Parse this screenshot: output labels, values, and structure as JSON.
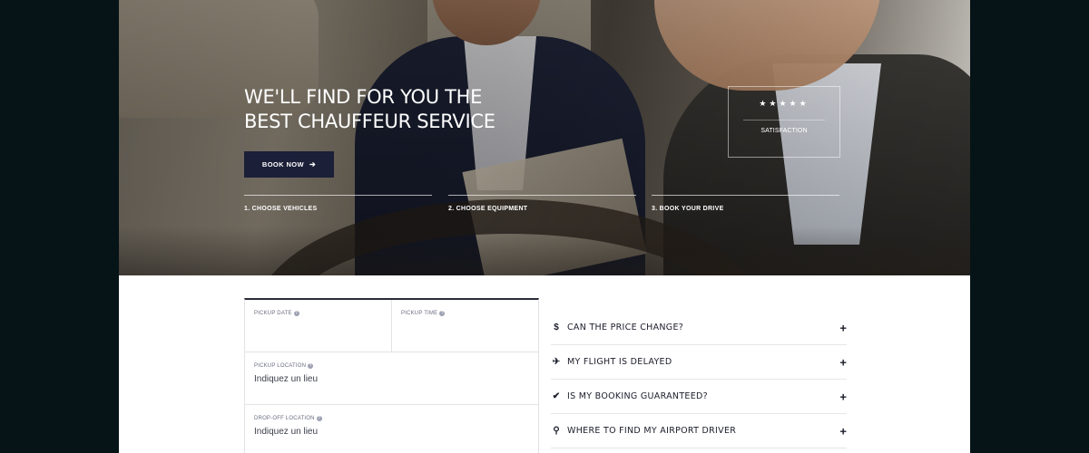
{
  "hero": {
    "title_line1": "WE'LL FIND FOR YOU THE",
    "title_line2": "BEST CHAUFFEUR SERVICE",
    "book_button": "BOOK NOW",
    "book_arrow": "➔",
    "steps": [
      "1. CHOOSE VEHICLES",
      "2. CHOOSE EQUIPMENT",
      "3. BOOK YOUR DRIVE"
    ],
    "rating": {
      "stars": "★★★★★",
      "label": "SATISFACTION"
    }
  },
  "form": {
    "pickup_date": {
      "label": "PICKUP DATE",
      "value": ""
    },
    "pickup_time": {
      "label": "PICKUP TIME",
      "value": ""
    },
    "pickup_location": {
      "label": "PICKUP LOCATION",
      "placeholder": "Indiquez un lieu"
    },
    "dropoff_location": {
      "label": "DROP-OFF LOCATION",
      "placeholder": "Indiquez un lieu"
    },
    "help_glyph": "?"
  },
  "faq": {
    "plus": "+",
    "items": [
      {
        "icon": "$",
        "icon_name": "dollar-icon",
        "question": "CAN THE PRICE CHANGE?"
      },
      {
        "icon": "✈",
        "icon_name": "plane-icon",
        "question": "MY FLIGHT IS DELAYED"
      },
      {
        "icon": "✔",
        "icon_name": "check-icon",
        "question": "IS MY BOOKING GUARANTEED?"
      },
      {
        "icon": "⚲",
        "icon_name": "map-pin-icon",
        "question": "WHERE TO FIND MY AIRPORT DRIVER"
      }
    ]
  },
  "colors": {
    "outer_background": "#061417",
    "button_navy": "#1b1f37",
    "text_dark": "#1b1d2a"
  }
}
